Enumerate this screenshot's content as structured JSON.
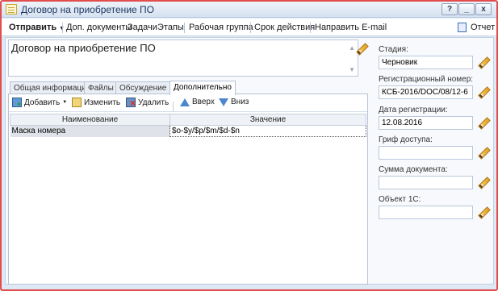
{
  "window": {
    "title": "Договор на приобретение ПО",
    "buttons": {
      "help": "?",
      "minimize": "_",
      "close": "x"
    }
  },
  "toolbar": {
    "send": "Отправить",
    "dop_docs": "Доп. документы",
    "tasks": "Задачи",
    "stages": "Этапы",
    "workgroup": "Рабочая группа",
    "deadline": "Срок действия",
    "email": "Направить E-mail",
    "report": "Отчет"
  },
  "subject": {
    "value": "Договор на приобретение ПО"
  },
  "tabs": [
    {
      "label": "Общая информация"
    },
    {
      "label": "Файлы"
    },
    {
      "label": "Обсуждение"
    },
    {
      "label": "Дополнительно"
    }
  ],
  "panel_toolbar": {
    "add": "Добавить",
    "edit": "Изменить",
    "delete": "Удалить",
    "up": "Вверх",
    "down": "Вниз"
  },
  "table": {
    "headers": {
      "name": "Наименование",
      "value": "Значение"
    },
    "rows": [
      {
        "name": "Маска номера",
        "value": "$o-$y/$p/$m/$d-$n"
      }
    ]
  },
  "side": {
    "stage_label": "Стадия:",
    "stage_value": "Черновик",
    "regnum_label": "Регистрационный номер:",
    "regnum_value": "КСБ-2016/DOC/08/12-6",
    "regdate_label": "Дата регистрации:",
    "regdate_value": "12.08.2016",
    "access_label": "Гриф доступа:",
    "access_value": "",
    "sum_label": "Сумма документа:",
    "sum_value": "",
    "obj_label": "Объект 1С:",
    "obj_value": ""
  },
  "icons": {
    "edit": "pencil-icon",
    "report": "report-icon",
    "add": "add-icon",
    "delete": "delete-icon",
    "up": "arrow-up-icon",
    "down": "arrow-down-icon"
  },
  "colors": {
    "window_border": "#e24d4d",
    "accent": "#4d86cf",
    "pencil": "#e6a020"
  }
}
